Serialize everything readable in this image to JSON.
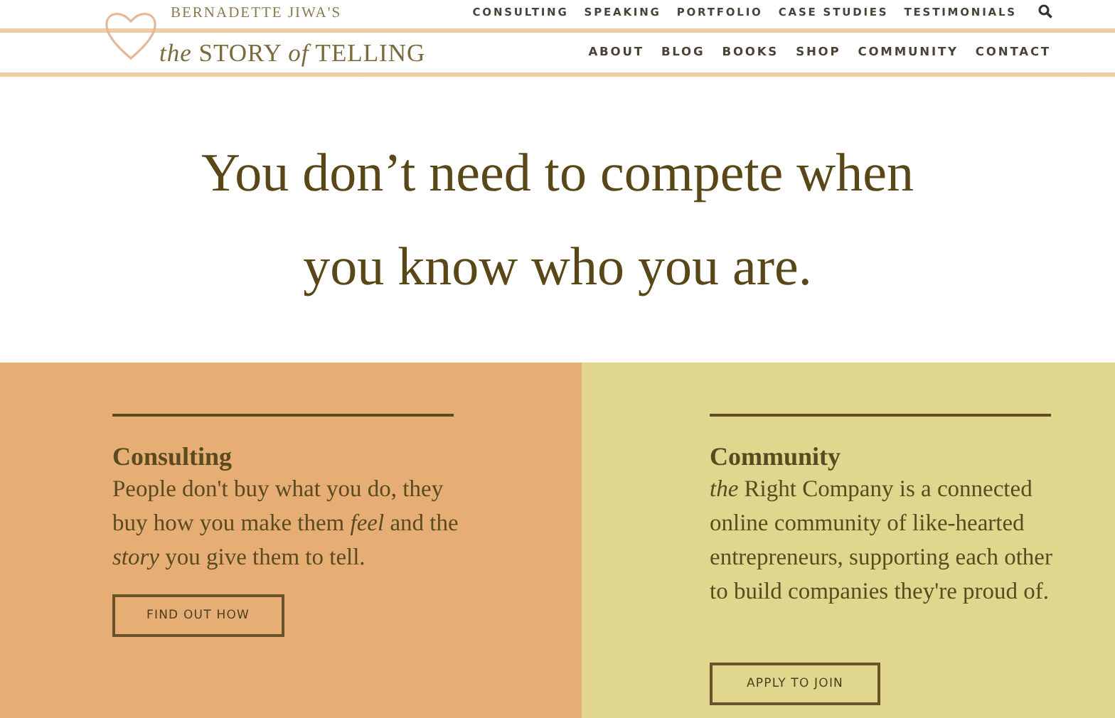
{
  "logo": {
    "byline": "BERNADETTE JIWA'S",
    "name": "*the* STORY *of* TELLING"
  },
  "top_nav": [
    "CONSULTING",
    "SPEAKING",
    "PORTFOLIO",
    "CASE STUDIES",
    "TESTIMONIALS"
  ],
  "main_nav": [
    "ABOUT",
    "BLOG",
    "BOOKS",
    "SHOP",
    "COMMUNITY",
    "CONTACT"
  ],
  "hero": {
    "lines": [
      "You don’t need to compete when",
      "you know who you are."
    ]
  },
  "panels": [
    {
      "title": "Consulting",
      "text": "People don't buy what you do, they buy how you make them *feel* and the *story* you give them to tell.",
      "button": "FIND OUT HOW",
      "color": "#e6ae75"
    },
    {
      "title": "Community",
      "text": "*the* Right Company is a connected online community of like-hearted entrepreneurs, supporting each other to build companies they're proud of.",
      "button": "APPLY TO JOIN",
      "color": "#e0d68e"
    }
  ]
}
